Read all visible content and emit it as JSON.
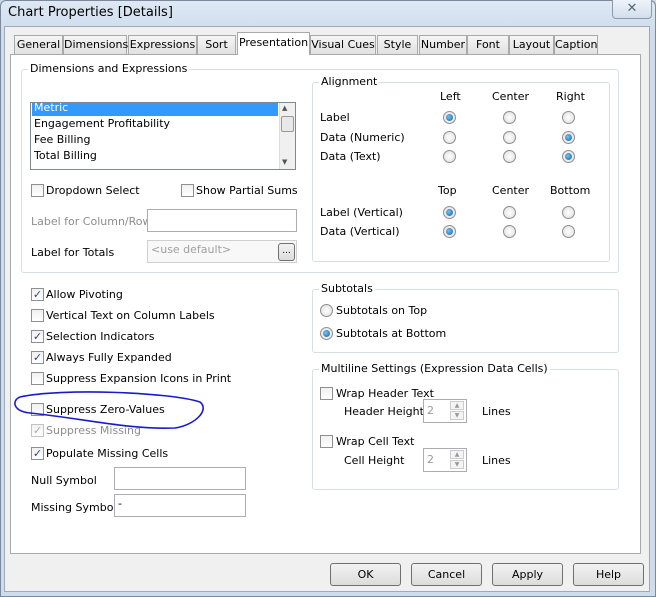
{
  "window": {
    "title": "Chart Properties [Details]",
    "close": "✕"
  },
  "tabs": [
    {
      "label": "General"
    },
    {
      "label": "Dimensions"
    },
    {
      "label": "Expressions"
    },
    {
      "label": "Sort"
    },
    {
      "label": "Presentation",
      "active": true
    },
    {
      "label": "Visual Cues"
    },
    {
      "label": "Style"
    },
    {
      "label": "Number"
    },
    {
      "label": "Font"
    },
    {
      "label": "Layout"
    },
    {
      "label": "Caption"
    }
  ],
  "dims": {
    "title": "Dimensions and Expressions",
    "items": [
      "Metric",
      "Engagement Profitability",
      "Fee Billing",
      "Total Billing"
    ],
    "selected": "Metric",
    "dropdown_select": "Dropdown Select",
    "show_partial_sums": "Show Partial Sums",
    "label_column_row": "Label for Column/Row",
    "label_column_row_value": "",
    "label_totals": "Label for Totals",
    "label_totals_placeholder": "<use default>",
    "browse": "..."
  },
  "alignment": {
    "title": "Alignment",
    "h_headers": [
      "Left",
      "Center",
      "Right"
    ],
    "h_rows": [
      {
        "label": "Label",
        "selected": "Left"
      },
      {
        "label": "Data (Numeric)",
        "selected": "Right"
      },
      {
        "label": "Data (Text)",
        "selected": "Right"
      }
    ],
    "v_headers": [
      "Top",
      "Center",
      "Bottom"
    ],
    "v_rows": [
      {
        "label": "Label (Vertical)",
        "selected": "Top"
      },
      {
        "label": "Data (Vertical)",
        "selected": "Top"
      }
    ]
  },
  "options": [
    {
      "label": "Allow Pivoting",
      "checked": true
    },
    {
      "label": "Vertical Text on Column Labels",
      "checked": false
    },
    {
      "label": "Selection Indicators",
      "checked": true
    },
    {
      "label": "Always Fully Expanded",
      "checked": true
    },
    {
      "label": "Suppress Expansion Icons in Print",
      "checked": false
    },
    {
      "label": "Suppress Zero-Values",
      "checked": false
    },
    {
      "label": "Suppress Missing",
      "checked": true,
      "disabled": true
    },
    {
      "label": "Populate Missing Cells",
      "checked": true
    }
  ],
  "symbols": {
    "null_label": "Null Symbol",
    "null_value": "",
    "missing_label": "Missing Symbol",
    "missing_value": "-"
  },
  "subtotals": {
    "title": "Subtotals",
    "on_top": "Subtotals on Top",
    "at_bottom": "Subtotals at Bottom",
    "selected": "Subtotals at Bottom"
  },
  "multiline": {
    "title": "Multiline Settings (Expression Data Cells)",
    "wrap_header": "Wrap Header Text",
    "header_height": "Header Height",
    "header_value": "2",
    "wrap_cell": "Wrap Cell Text",
    "cell_height": "Cell Height",
    "cell_value": "2",
    "lines": "Lines"
  },
  "buttons": {
    "ok": "OK",
    "cancel": "Cancel",
    "apply": "Apply",
    "help": "Help"
  },
  "annotation_color": "#1a1acc"
}
